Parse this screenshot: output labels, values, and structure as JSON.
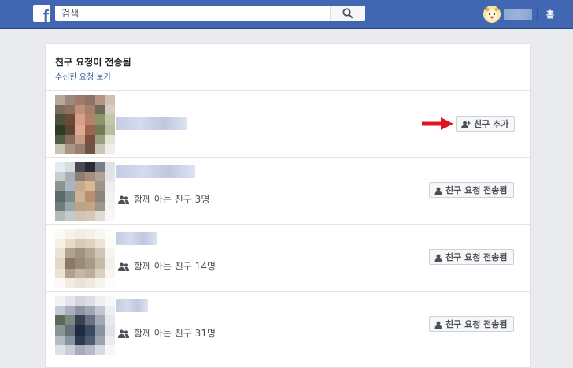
{
  "topbar": {
    "logo_letter": "f",
    "search_placeholder": "검색",
    "home_label": "홈",
    "colors": {
      "bar": "#4267b2",
      "accent": "#365899",
      "arrow": "#e0141e"
    }
  },
  "card": {
    "title": "친구 요청이 전송됨",
    "link": "수신한 요청 보기"
  },
  "requests": [
    {
      "mutual_text": "",
      "button_label": "친구 추가",
      "button_icon": "add-friend-icon"
    },
    {
      "mutual_text": "함께 아는 친구 3명",
      "button_label": "친구 요청 전송됨",
      "button_icon": "person-icon"
    },
    {
      "mutual_text": "함께 아는 친구 14명",
      "button_label": "친구 요청 전송됨",
      "button_icon": "person-icon"
    },
    {
      "mutual_text": "함께 아는 친구 31명",
      "button_label": "친구 요청 전송됨",
      "button_icon": "person-icon"
    }
  ]
}
